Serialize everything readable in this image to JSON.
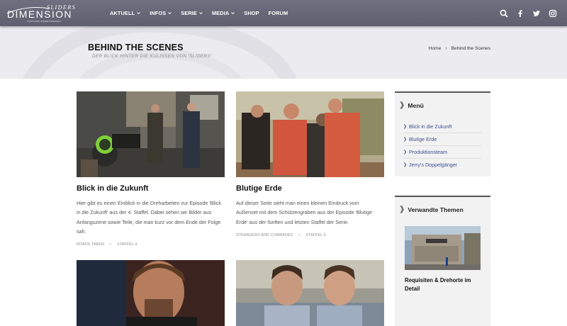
{
  "logo": {
    "top": "SLIDERS",
    "main": "DIMENSION",
    "sub": "YOUR PLANET   INTERNET   DIMENSION"
  },
  "nav": {
    "items": [
      {
        "label": "AKTUELL",
        "dropdown": true
      },
      {
        "label": "INFOS",
        "dropdown": true
      },
      {
        "label": "SERIE",
        "dropdown": true
      },
      {
        "label": "MEDIA",
        "dropdown": true
      },
      {
        "label": "SHOP",
        "dropdown": false
      },
      {
        "label": "FORUM",
        "dropdown": false
      }
    ],
    "social_icons": [
      "search-icon",
      "facebook-icon",
      "twitter-icon",
      "instagram-icon"
    ]
  },
  "hero": {
    "title": "BEHIND THE SCENES",
    "subtitle": "DER BLICK HINTER DIE KULISSEN VON 'SLIDERS'",
    "breadcrumb": {
      "home": "Home",
      "separator": "›",
      "current": "Behind the Scenes"
    }
  },
  "posts": [
    {
      "title": "Blick in die Zukunft",
      "excerpt": "Hier gibt es einen Einblick in die Dreharbeiten zur Episode 'Blick in die Zukunft' aus der 4. Staffel. Dabei sehen wir Bilder aus Anfangszene sowie Teile, die man kurz vor dem Ende der Folge sah.",
      "tags": [
        "ROADS TAKEN",
        "STAFFEL 4"
      ]
    },
    {
      "title": "Blutige Erde",
      "excerpt": "Auf dieser Seite sieht man einen kleinen Eindruck vom Außenset mit dem Schützengraben aus der Episode 'Blutige Erde' aus der fünften und letzten Staffel der Serie.",
      "tags": [
        "STRANGERS AND COMRADES",
        "STAFFEL 5"
      ]
    }
  ],
  "meta_separator": "›",
  "sidebar": {
    "menu": {
      "title": "Menü",
      "items": [
        "Blick in die Zukunft",
        "Blutige Erde",
        "Produktionsteam",
        "Jerry's Doppelgänger"
      ]
    },
    "related": {
      "title": "Verwandte Themen",
      "post_title": "Requisiten & Drehorte im Detail"
    }
  },
  "colors": {
    "nav_bg": "#66667a",
    "link": "#3e4f8f",
    "hero_bg": "#ececf0"
  }
}
